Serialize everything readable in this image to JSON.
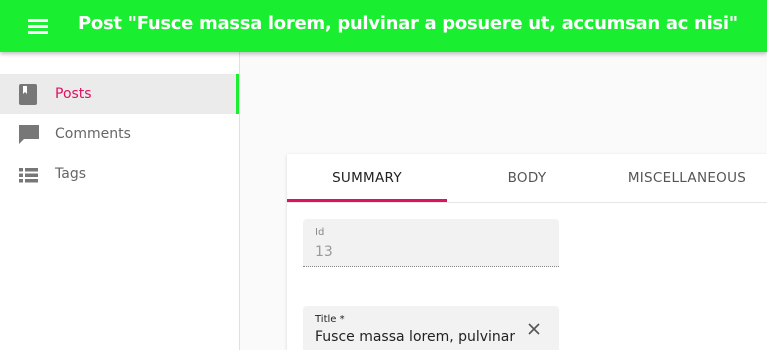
{
  "app": {
    "title": "Post \"Fusce massa lorem, pulvinar a posuere ut, accumsan ac nisi\"",
    "accent_color": "#1aee30",
    "active_color": "#e0115f"
  },
  "menu": {
    "icon": "menu-icon"
  },
  "sidebar": {
    "items": [
      {
        "label": "Posts",
        "icon": "book-icon",
        "active": true
      },
      {
        "label": "Comments",
        "icon": "comment-icon",
        "active": false
      },
      {
        "label": "Tags",
        "icon": "list-icon",
        "active": false
      }
    ]
  },
  "tabs": [
    {
      "label": "SUMMARY",
      "active": true
    },
    {
      "label": "BODY",
      "active": false
    },
    {
      "label": "MISCELLANEOUS",
      "active": false
    }
  ],
  "form": {
    "id_field": {
      "label": "Id",
      "value": "13"
    },
    "title_field": {
      "label": "Title *",
      "value": "Fusce massa lorem, pulvinar a posuere ut, accumsan ac nisi"
    }
  }
}
